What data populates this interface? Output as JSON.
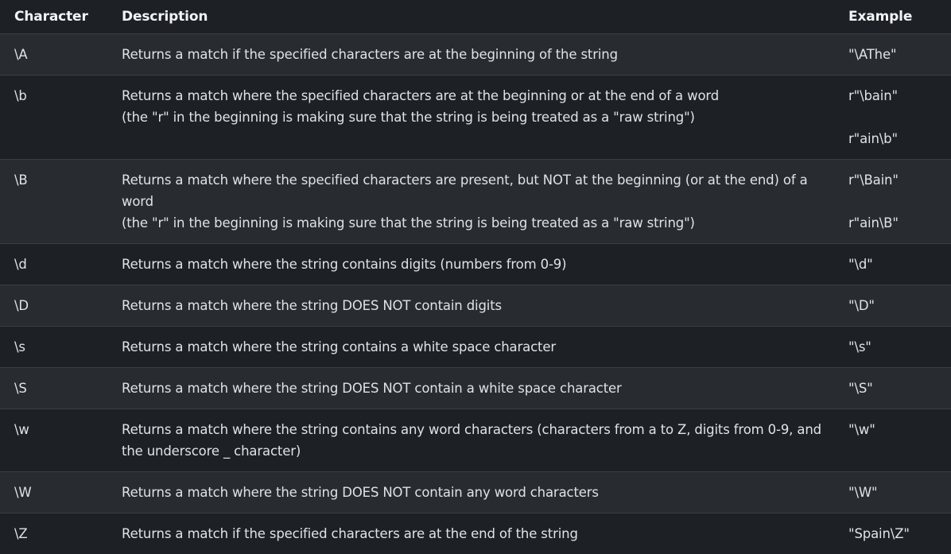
{
  "table": {
    "headers": [
      "Character",
      "Description",
      "Example"
    ],
    "rows": [
      {
        "character": "\\A",
        "description": [
          "Returns a match if the specified characters are at the beginning of the string"
        ],
        "examples": [
          "\"\\AThe\""
        ]
      },
      {
        "character": "\\b",
        "description": [
          "Returns a match where the specified characters are at the beginning or at the end of a word",
          "(the \"r\" in the beginning is making sure that the string is being treated as a \"raw string\")"
        ],
        "examples": [
          "r\"\\bain\"",
          "r\"ain\\b\""
        ]
      },
      {
        "character": "\\B",
        "description": [
          "Returns a match where the specified characters are present, but NOT at the beginning (or at the end) of a word",
          "(the \"r\" in the beginning is making sure that the string is being treated as a \"raw string\")"
        ],
        "examples": [
          "r\"\\Bain\"",
          "r\"ain\\B\""
        ]
      },
      {
        "character": "\\d",
        "description": [
          "Returns a match where the string contains digits (numbers from 0-9)"
        ],
        "examples": [
          "\"\\d\""
        ]
      },
      {
        "character": "\\D",
        "description": [
          "Returns a match where the string DOES NOT contain digits"
        ],
        "examples": [
          "\"\\D\""
        ]
      },
      {
        "character": "\\s",
        "description": [
          "Returns a match where the string contains a white space character"
        ],
        "examples": [
          "\"\\s\""
        ]
      },
      {
        "character": "\\S",
        "description": [
          "Returns a match where the string DOES NOT contain a white space character"
        ],
        "examples": [
          "\"\\S\""
        ]
      },
      {
        "character": "\\w",
        "description": [
          "Returns a match where the string contains any word characters (characters from a to Z, digits from 0-9, and the underscore _ character)"
        ],
        "examples": [
          "\"\\w\""
        ]
      },
      {
        "character": "\\W",
        "description": [
          "Returns a match where the string DOES NOT contain any word characters"
        ],
        "examples": [
          "\"\\W\""
        ]
      },
      {
        "character": "\\Z",
        "description": [
          "Returns a match if the specified characters are at the end of the string"
        ],
        "examples": [
          "\"Spain\\Z\""
        ]
      }
    ]
  }
}
